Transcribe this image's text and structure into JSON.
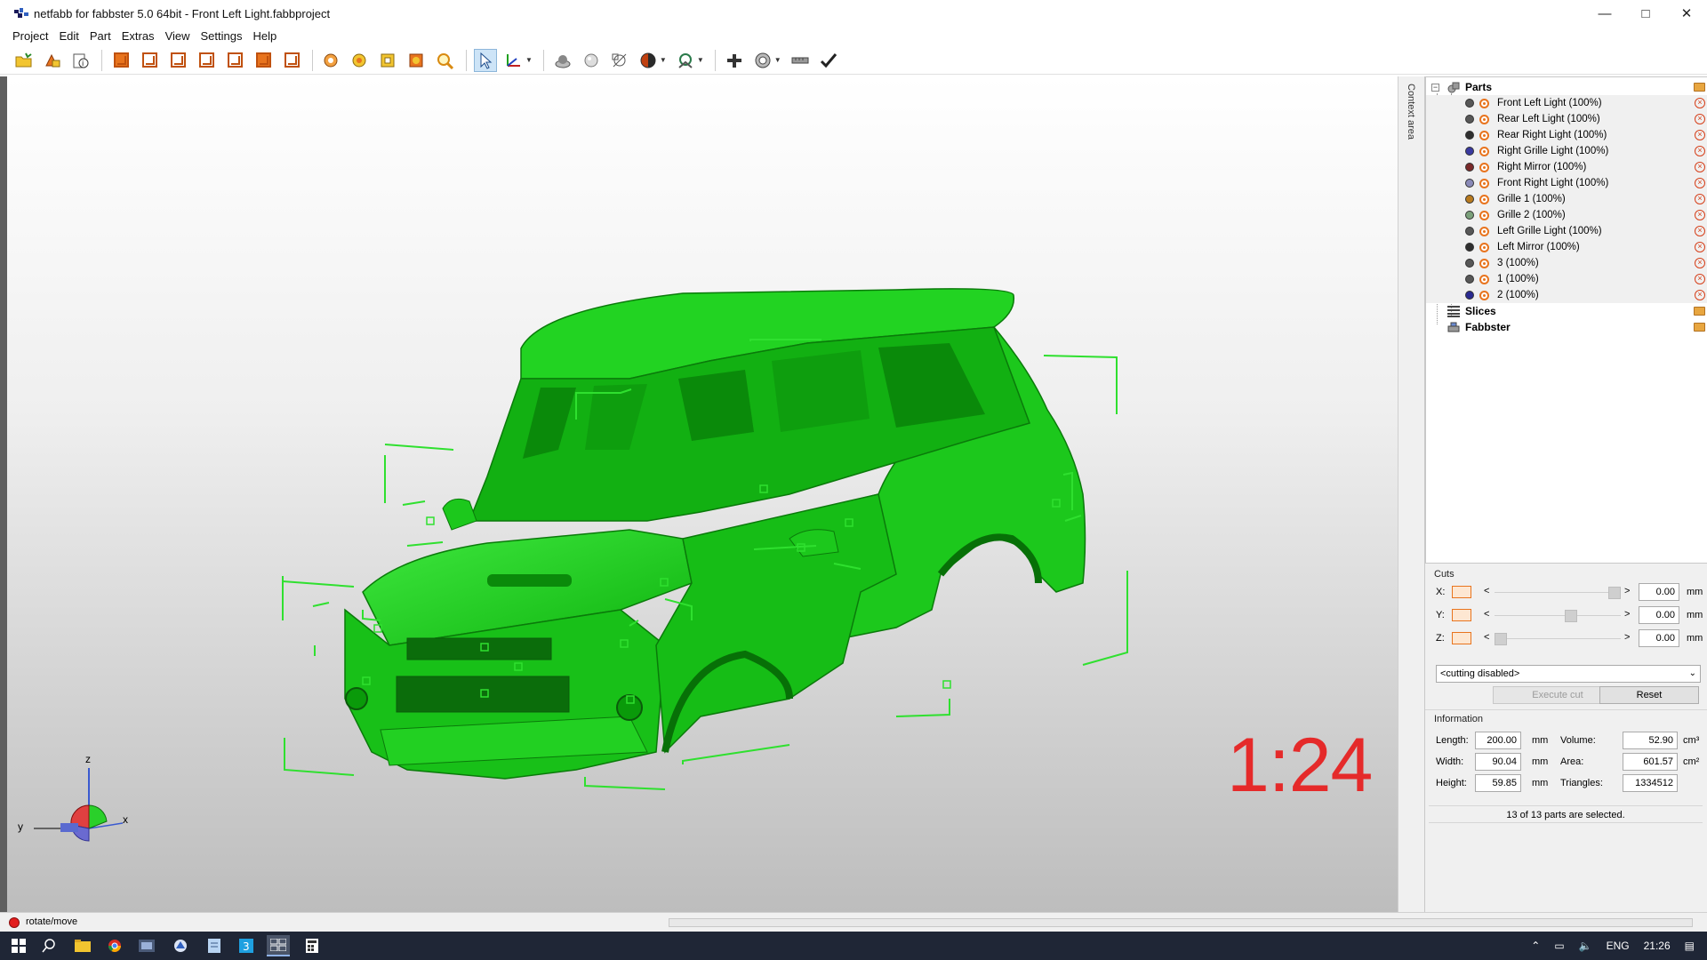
{
  "window": {
    "title": "netfabb for fabbster 5.0 64bit - Front Left Light.fabbproject",
    "controls": [
      "minimize-icon",
      "maximize-icon",
      "close-icon"
    ]
  },
  "menu": [
    "Project",
    "Edit",
    "Part",
    "Extras",
    "View",
    "Settings",
    "Help"
  ],
  "toolbar": {
    "icons": [
      "open-project-icon",
      "add-part-icon",
      "part-info-icon",
      "view-perspective-icon",
      "view-front-icon",
      "view-back-icon",
      "view-left-icon",
      "view-right-icon",
      "view-top-icon",
      "view-bottom-icon",
      "zoom-selection-icon",
      "zoom-all-icon",
      "zoom-window-icon",
      "zoom-parts-icon",
      "zoom-magnifier-icon",
      "select-tool-icon",
      "move-axis-icon",
      "render-solid-icon",
      "render-shaded-icon",
      "render-wire-icon",
      "color-mode-icon",
      "mesh-analysis-icon",
      "add-icon",
      "repair-icon",
      "measure-icon",
      "apply-icon"
    ]
  },
  "viewport": {
    "scale_label": "1:24",
    "model_color": "#19d419",
    "axes": {
      "x": "x",
      "y": "y",
      "z": "z"
    }
  },
  "context_area": {
    "label": "Context area"
  },
  "tree": {
    "parts_group": "Parts",
    "parts": [
      {
        "label": "Front Left Light (100%)",
        "color": "#575757"
      },
      {
        "label": "Rear Left Light (100%)",
        "color": "#575757"
      },
      {
        "label": "Rear Right Light (100%)",
        "color": "#2f2f2f"
      },
      {
        "label": "Right Grille Light (100%)",
        "color": "#3a3aa0"
      },
      {
        "label": "Right Mirror (100%)",
        "color": "#7a2a2a"
      },
      {
        "label": "Front Right Light (100%)",
        "color": "#8a8ab8"
      },
      {
        "label": "Grille 1 (100%)",
        "color": "#b87a1e"
      },
      {
        "label": "Grille 2 (100%)",
        "color": "#7aa07a"
      },
      {
        "label": "Left Grille Light (100%)",
        "color": "#575757"
      },
      {
        "label": "Left Mirror (100%)",
        "color": "#2f2f2f"
      },
      {
        "label": "3 (100%)",
        "color": "#575757"
      },
      {
        "label": "1 (100%)",
        "color": "#575757"
      },
      {
        "label": "2 (100%)",
        "color": "#2a2a90"
      }
    ],
    "slices_group": "Slices",
    "fabbster_group": "Fabbster"
  },
  "cuts": {
    "title": "Cuts",
    "rows": [
      {
        "axis": "X:",
        "value": "0.00",
        "unit": "mm",
        "position": 1.0
      },
      {
        "axis": "Y:",
        "value": "0.00",
        "unit": "mm",
        "position": 0.62
      },
      {
        "axis": "Z:",
        "value": "0.00",
        "unit": "mm",
        "position": 0.0
      }
    ],
    "lt": "<",
    "gt": ">",
    "mode": "<cutting disabled>",
    "execute_label": "Execute cut",
    "reset_label": "Reset"
  },
  "info": {
    "title": "Information",
    "length_label": "Length:",
    "length": "200.00",
    "length_unit": "mm",
    "width_label": "Width:",
    "width": "90.04",
    "width_unit": "mm",
    "height_label": "Height:",
    "height": "59.85",
    "height_unit": "mm",
    "volume_label": "Volume:",
    "volume": "52.90",
    "volume_unit": "cm³",
    "area_label": "Area:",
    "area": "601.57",
    "area_unit": "cm²",
    "triangles_label": "Triangles:",
    "triangles": "1334512",
    "selection_status": "13 of 13 parts are selected."
  },
  "statusbar": {
    "message": "rotate/move"
  },
  "taskbar": {
    "apps": [
      "windows-start-icon",
      "search-icon",
      "file-explorer-icon",
      "chrome-icon",
      "app-icon",
      "netfabb-icon",
      "notes-icon",
      "app-icon-2",
      "netfabb-active-icon",
      "calculator-icon"
    ],
    "language": "ENG",
    "time": "21:26"
  }
}
